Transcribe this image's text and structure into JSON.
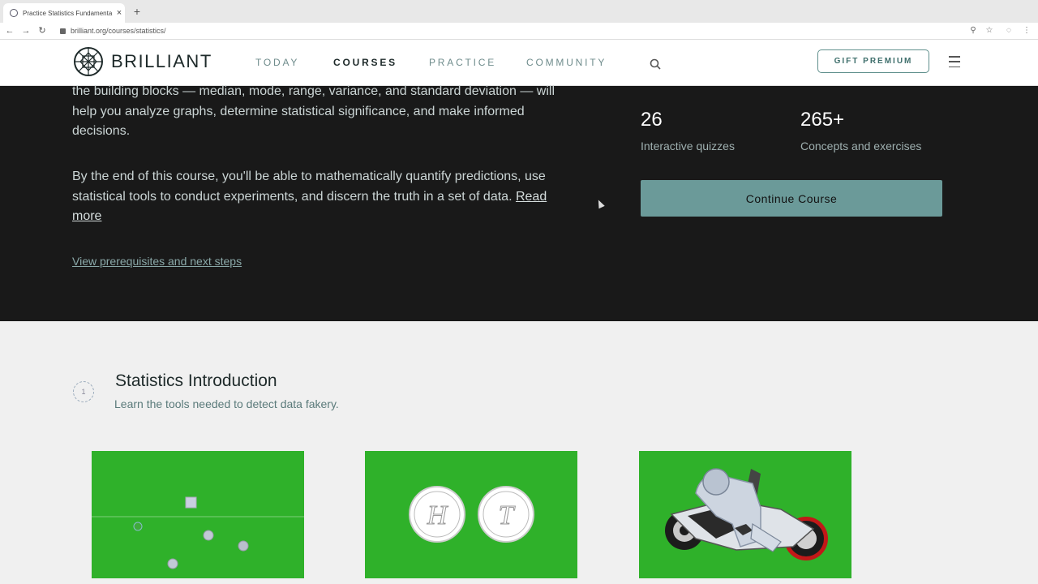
{
  "browser": {
    "tab_title": "Practice Statistics Fundamenta",
    "url": "brilliant.org/courses/statistics/",
    "new_tab": "+",
    "close": "×"
  },
  "header": {
    "brand": "BRILLIANT",
    "nav": [
      {
        "label": "TODAY"
      },
      {
        "label": "COURSES"
      },
      {
        "label": "PRACTICE"
      },
      {
        "label": "COMMUNITY"
      }
    ],
    "gift_label": "GIFT PREMIUM"
  },
  "hero": {
    "description_1": "the building blocks — median, mode, range, variance, and standard deviation — will help you analyze graphs, determine statistical significance, and make informed decisions.",
    "description_2": "By the end of this course, you'll be able to mathematically quantify predictions, use statistical tools to conduct experiments, and discern the truth in a set of data.",
    "read_more": "Read more",
    "prereq_link": "View prerequisites and next steps",
    "stats": [
      {
        "value": "26",
        "label": "Interactive quizzes"
      },
      {
        "value": "265+",
        "label": "Concepts and exercises"
      }
    ],
    "continue_label": "Continue Course"
  },
  "chapter": {
    "number": "1",
    "title": "Statistics Introduction",
    "subtitle": "Learn the tools needed to detect data fakery."
  },
  "cards": {
    "coin_heads": "H",
    "coin_tails": "T"
  },
  "colors": {
    "accent": "#6b9a99",
    "hero_bg": "#191919",
    "card_green": "#2fb12a"
  }
}
